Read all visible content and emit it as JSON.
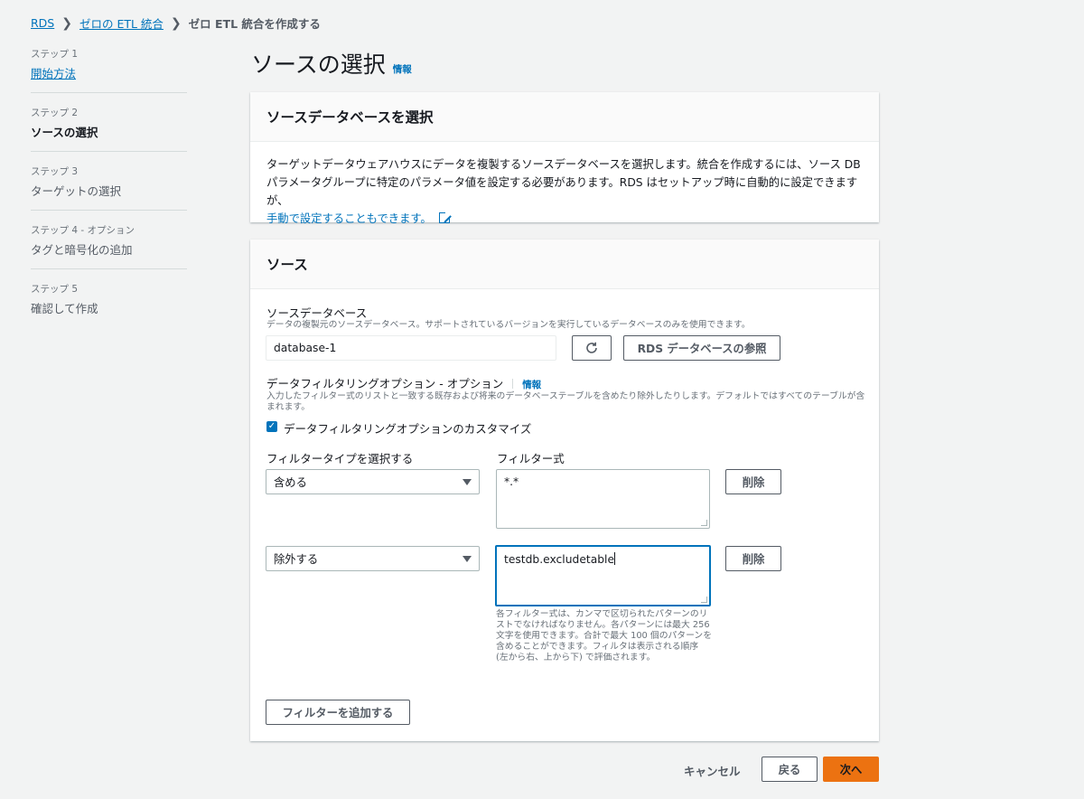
{
  "breadcrumb": {
    "items": [
      "RDS",
      "ゼロの ETL 統合"
    ],
    "current": "ゼロ ETL 統合を作成する"
  },
  "steps": [
    {
      "num": "ステップ 1",
      "name": "開始方法"
    },
    {
      "num": "ステップ 2",
      "name": "ソースの選択"
    },
    {
      "num": "ステップ 3",
      "name": "ターゲットの選択"
    },
    {
      "num": "ステップ 4 - オプション",
      "name": "タグと暗号化の追加"
    },
    {
      "num": "ステップ 5",
      "name": "確認して作成"
    }
  ],
  "page": {
    "title": "ソースの選択",
    "info": "情報"
  },
  "panel1": {
    "title": "ソースデータベースを選択",
    "text": "ターゲットデータウェアハウスにデータを複製するソースデータベースを選択します。統合を作成するには、ソース DB パラメータグループに特定のパラメータ値を設定する必要があります。RDS はセットアップ時に自動的に設定できますが、",
    "link": "手動で設定することもできます。"
  },
  "panel2": {
    "title": "ソース",
    "source_db": {
      "label": "ソースデータベース",
      "desc": "データの複製元のソースデータベース。サポートされているバージョンを実行しているデータベースのみを使用できます。",
      "value": "database-1",
      "refresh_icon": "refresh-icon",
      "browse": "RDS データベースの参照"
    },
    "filter_opt": {
      "label": "データフィルタリングオプション - オプション",
      "info": "情報",
      "desc": "入力したフィルター式のリストと一致する既存および将来のデータベーステーブルを含めたり除外したりします。デフォルトではすべてのテーブルが含まれます。",
      "checkbox": "データフィルタリングオプションのカスタマイズ"
    },
    "filters": {
      "type_label": "フィルタータイプを選択する",
      "expr_label": "フィルター式",
      "rows": [
        {
          "type": "含める",
          "expr": "*.*",
          "remove": "削除"
        },
        {
          "type": "除外する",
          "expr": "testdb.excludetable",
          "remove": "削除"
        }
      ],
      "hint": "各フィルター式は、カンマで区切られたパターンのリストでなければなりません。各パターンには最大 256 文字を使用できます。合計で最大 100 個のパターンを含めることができます。フィルタは表示される順序 (左から右、上から下) で評価されます。",
      "add": "フィルターを追加する"
    }
  },
  "footer": {
    "cancel": "キャンセル",
    "back": "戻る",
    "next": "次へ"
  },
  "colors": {
    "accent": "#0073bb",
    "primary": "#ec7211",
    "background": "#f2f3f3"
  }
}
